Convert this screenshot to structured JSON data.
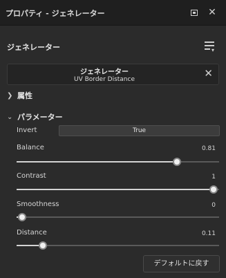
{
  "titlebar": {
    "title": "プロパティ - ジェネレーター",
    "restore_icon": "restore-icon",
    "close_icon": "close-icon"
  },
  "section": {
    "title": "ジェネレーター",
    "menu_icon": "list-menu-icon"
  },
  "generator": {
    "name": "ジェネレーター",
    "type": "UV Border Distance",
    "clear_icon": "close-icon"
  },
  "groups": {
    "attributes": {
      "label": "属性",
      "expanded": false
    },
    "parameters": {
      "label": "パラメーター",
      "expanded": true
    }
  },
  "params": {
    "invert": {
      "label": "Invert",
      "value": "True"
    },
    "balance": {
      "label": "Balance",
      "value": "0.81",
      "fraction": 0.81
    },
    "contrast": {
      "label": "Contrast",
      "value": "1",
      "fraction": 1.0
    },
    "smoothness": {
      "label": "Smoothness",
      "value": "0",
      "fraction": 0.0
    },
    "distance": {
      "label": "Distance",
      "value": "0.11",
      "fraction": 0.11
    }
  },
  "footer": {
    "reset_label": "デフォルトに戻す"
  }
}
